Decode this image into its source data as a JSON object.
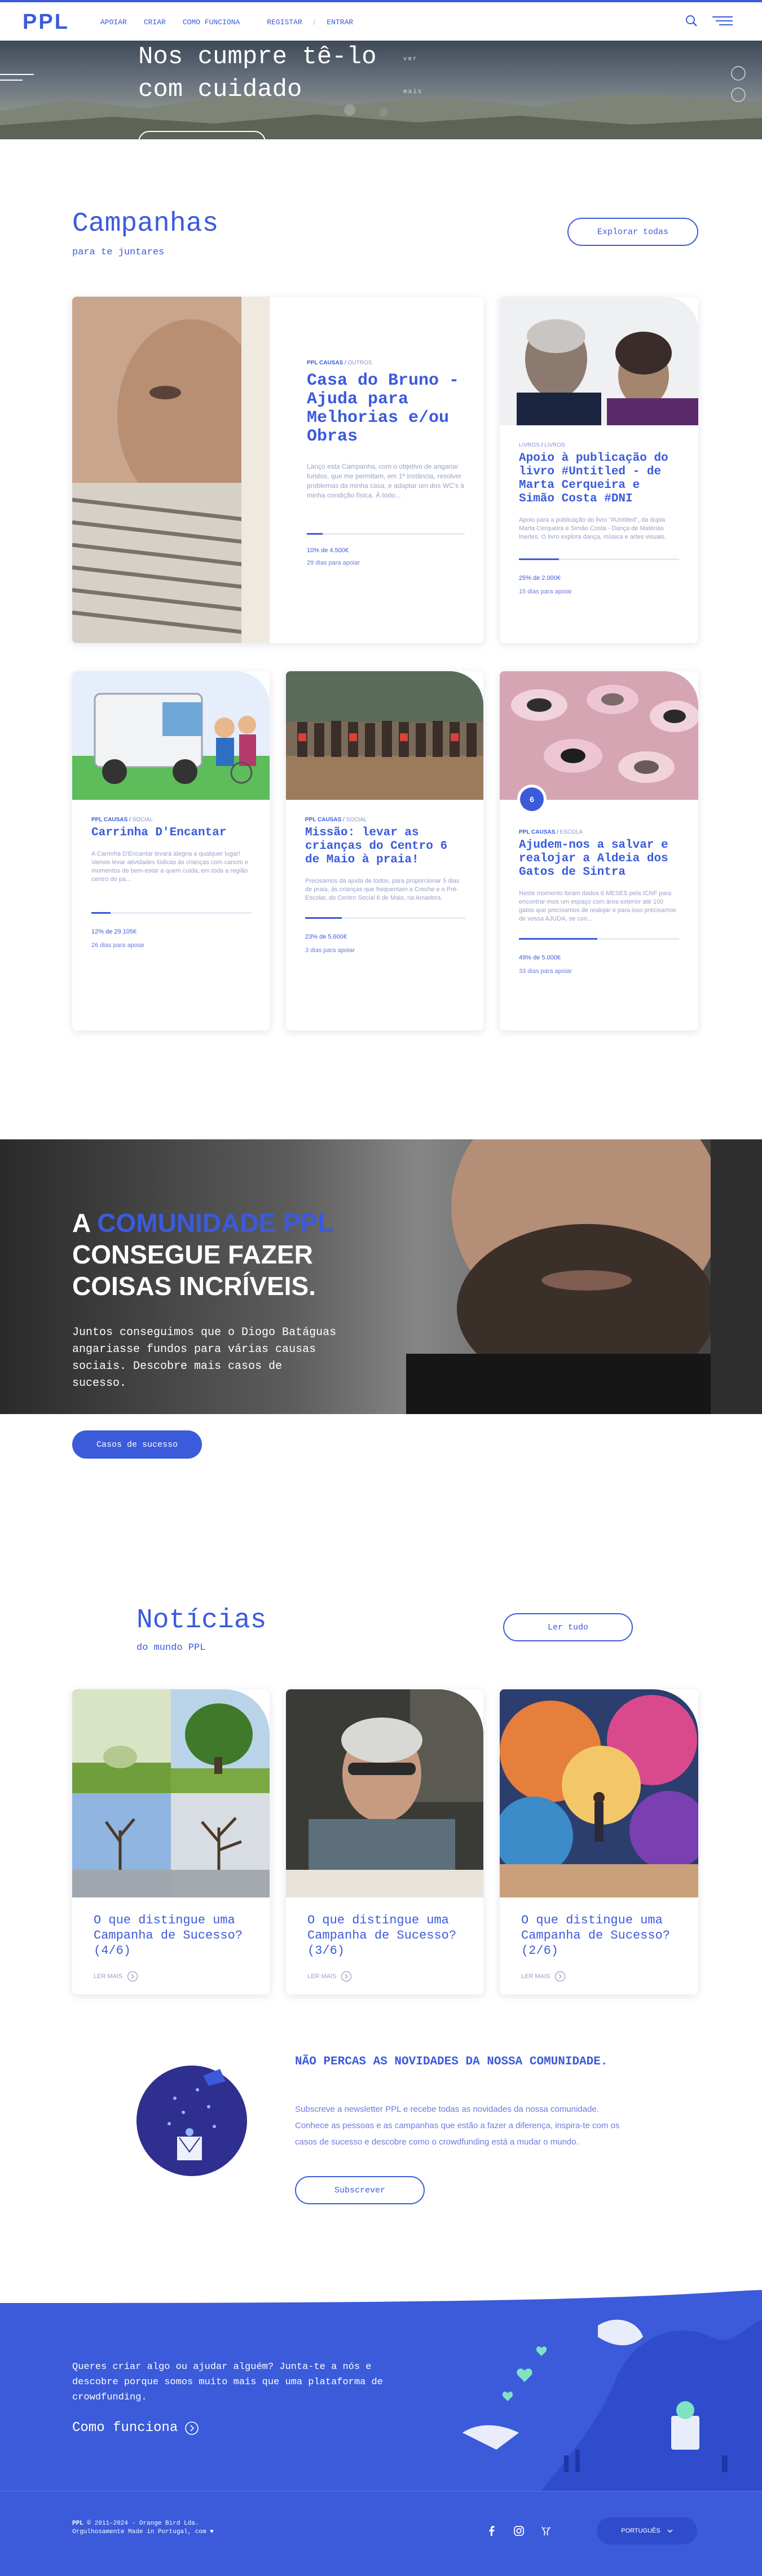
{
  "brand": {
    "logo": "PPL",
    "accent": "#3b5bdb",
    "dark_accent": "#2f4ccc"
  },
  "nav": {
    "items": [
      {
        "label": "APOIAR"
      },
      {
        "label": "CRIAR"
      },
      {
        "label": "COMO FUNCIONA"
      }
    ],
    "auth": {
      "register": "REGISTAR",
      "separator": "/",
      "login": "ENTRAR"
    },
    "icons": [
      "search-icon",
      "menu-icon"
    ]
  },
  "hero": {
    "title_line1": "Nos cumpre tê-lo",
    "title_line2": "com cuidado",
    "small_text": "ver mais"
  },
  "campaigns": {
    "title": "Campanhas",
    "subtitle": "para te juntares",
    "explore_label": "Explorar todas",
    "cards": [
      {
        "platform": "PPL CAUSAS",
        "category": "OUTROS",
        "title": "Casa do Bruno - Ajuda para Melhorias e/ou Obras",
        "description": "Lanço esta Campanha, com o objetivo de angariar fundos, que me permitam, em 1ª instância, resolver problemas da minha casa, e adaptar um dos WC's à minha condição física. À todo...",
        "progress": 0.1,
        "funded": "10% de 4.500€",
        "days": "29 dias para apoiar"
      },
      {
        "platform": "LIVROS",
        "category": "LIVROS",
        "title": "Apoio à publicação do livro #Untitled - de Marta Cerqueira e Simão Costa #DNI",
        "description": "Apoio para a publicação do livro \"#Untitled\", da dupla Marta Cerqueira e Simão Costa - Dança de Matérias Inertes. O livro explora dança, música e artes visuais.",
        "progress": 0.25,
        "funded": "25% de 2.000€",
        "days": "15 dias para apoiar"
      },
      {
        "platform": "PPL CAUSAS",
        "category": "SOCIAL",
        "title": "Carrinha D'Encantar",
        "description": "A Carrinha D'Encantar levará alegria a qualquer lugar! Vamos levar atividades lúdicas às crianças com cancro e momentos de bem-estar a quem cuida, em toda a região centro do pa...",
        "progress": 0.12,
        "funded": "12% de 29.105€",
        "days": "26 dias para apoiar"
      },
      {
        "platform": "PPL CAUSAS",
        "category": "SOCIAL",
        "title": "Missão: levar as crianças do Centro 6 de Maio à praia!",
        "description": "Precisamos da ajuda de todos, para proporcionar 5 dias de praia, às crianças que frequentam a Creche e o Pré-Escolar, do Centro Social 6 de Maio, na Amadora.",
        "progress": 0.23,
        "funded": "23% de 5.600€",
        "days": "3 dias para apoiar"
      },
      {
        "platform": "PPL CAUSAS",
        "category": "ESCOLA",
        "title": "Ajudem-nos a salvar e realojar a Aldeia dos Gatos de Sintra",
        "description": "Neste momento foram dados 6 MESES pela ICNF para encontrar-mos um espaço com área exterior até 100 gatos que precisamos de realojar e para isso precisamos de vossa AJUDA, se con...",
        "progress": 0.49,
        "funded": "49% de 5.000€",
        "days": "33 dias para apoiar",
        "badge": "6"
      }
    ]
  },
  "community": {
    "heading_prefix": "A",
    "heading_accent": "COMUNIDADE PPL",
    "heading_line2": "CONSEGUE FAZER",
    "heading_line3": "COISAS INCRÍVEIS.",
    "text": "Juntos conseguimos que o Diogo Batáguas angariasse fundos para várias causas sociais. Descobre mais casos de sucesso.",
    "button_label": "Casos de sucesso"
  },
  "news": {
    "title": "Notícias",
    "subtitle": "do mundo PPL",
    "read_all_label": "Ler tudo",
    "items": [
      {
        "title": "O que distingue uma Campanha de Sucesso? (4/6)",
        "read_more": "LER MAIS"
      },
      {
        "title": "O que distingue uma Campanha de Sucesso? (3/6)",
        "read_more": "LER MAIS"
      },
      {
        "title": "O que distingue uma Campanha de Sucesso? (2/6)",
        "read_more": "LER MAIS"
      }
    ]
  },
  "newsletter": {
    "title": "NÃO PERCAS AS NOVIDADES DA NOSSA COMUNIDADE.",
    "line1": "Subscreve a newsletter PPL e recebe todas as novidades da nossa comunidade.",
    "line2": "Conhece as pessoas e as campanhas que estão a fazer a diferença, inspira-te com os",
    "line3": "casos de sucesso e descobre como o crowdfunding está a mudar o mundo.",
    "button_label": "Subscrever"
  },
  "footer": {
    "question": "Queres criar algo ou ajudar alguém? Junta-te a nós e descobre porque somos muito mais que uma plataforma de crowdfunding.",
    "how_link": "Como funciona",
    "copyright_brand": "PPL",
    "copyright": "© 2011–2024 - Orange Bird Lda.",
    "made_in": "Orgulhosamente Made in Portugal, com",
    "language": "PORTUGUÊS",
    "social_icons": [
      "facebook-icon",
      "instagram-icon",
      "untappd-icon"
    ]
  }
}
